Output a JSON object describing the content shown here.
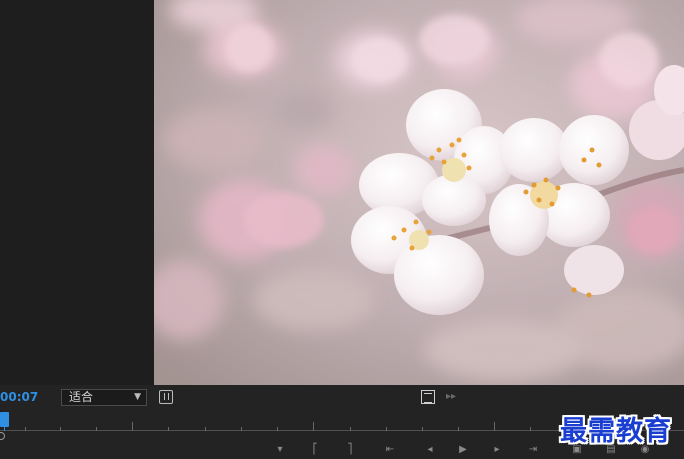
{
  "monitor": {
    "timecode": "00:07",
    "zoom_label": "适合"
  },
  "watermark": {
    "text": "最需教育"
  },
  "icons": {
    "settings": "wrench-settings-icon",
    "safe_margins": "safe-margins-icon",
    "step": "step-forward-icon"
  }
}
